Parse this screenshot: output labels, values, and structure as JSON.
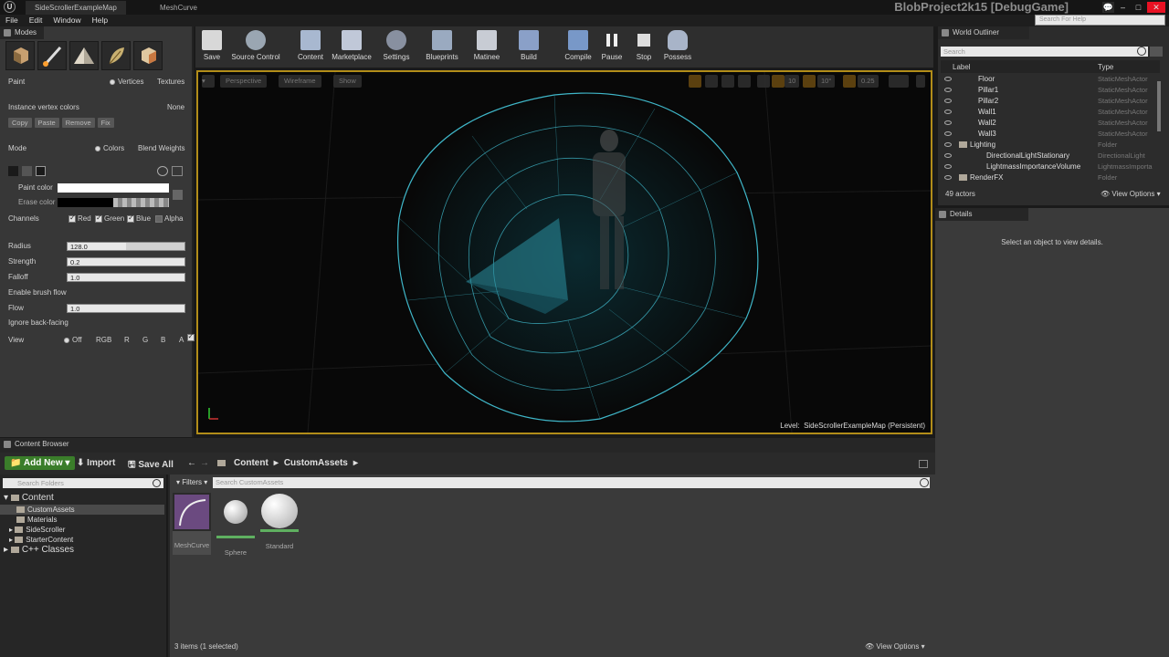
{
  "titlebar": {
    "logo": "U",
    "tabs": [
      "SideScrollerExampleMap",
      "MeshCurve"
    ],
    "project_title": "BlobProject2k15 [DebugGame]",
    "help_search_placeholder": "Search For Help",
    "window_buttons": [
      "–",
      "□",
      "✕"
    ]
  },
  "menubar": {
    "items": [
      "File",
      "Edit",
      "Window",
      "Help"
    ]
  },
  "modes": {
    "tab_label": "Modes",
    "paint_label": "Paint",
    "paint_options": [
      "Vertices",
      "Textures"
    ],
    "instance_vertex_colors": "Instance vertex colors",
    "instance_value": "None",
    "instance_buttons": [
      "Copy",
      "Paste",
      "Remove",
      "Fix"
    ],
    "mode_label": "Mode",
    "mode_options": [
      "Colors",
      "Blend Weights"
    ],
    "paint_color_label": "Paint color",
    "erase_color_label": "Erase color",
    "channels_label": "Channels",
    "channels": [
      "Red",
      "Green",
      "Blue",
      "Alpha"
    ],
    "radius_label": "Radius",
    "radius_value": "128.0",
    "strength_label": "Strength",
    "strength_value": "0.2",
    "falloff_label": "Falloff",
    "falloff_value": "1.0",
    "enable_brush_flow": "Enable brush flow",
    "flow_label": "Flow",
    "flow_value": "1.0",
    "ignore_back_facing": "Ignore back-facing",
    "view_label": "View",
    "view_options": [
      "Off",
      "RGB",
      "R",
      "G",
      "B",
      "A"
    ]
  },
  "toolbar": {
    "buttons": [
      "Save",
      "Source Control",
      "Content",
      "Marketplace",
      "Settings",
      "Blueprints",
      "Matinee",
      "Build",
      "Compile",
      "Pause",
      "Stop",
      "Possess"
    ]
  },
  "viewport": {
    "buttons": [
      "Perspective",
      "Wireframe",
      "Show"
    ],
    "grid_values": [
      "10",
      "10°",
      "0.25"
    ],
    "level_label": "Level:",
    "level_name": "SideScrollerExampleMap (Persistent)"
  },
  "outliner": {
    "tab_label": "World Outliner",
    "search_placeholder": "Search",
    "col_label": "Label",
    "col_type": "Type",
    "rows": [
      {
        "label": "Floor",
        "type": "StaticMeshActor"
      },
      {
        "label": "Pillar1",
        "type": "StaticMeshActor"
      },
      {
        "label": "Pillar2",
        "type": "StaticMeshActor"
      },
      {
        "label": "Wall1",
        "type": "StaticMeshActor"
      },
      {
        "label": "Wall2",
        "type": "StaticMeshActor"
      },
      {
        "label": "Wall3",
        "type": "StaticMeshActor"
      },
      {
        "label": "Lighting",
        "type": "Folder"
      },
      {
        "label": "DirectionalLightStationary",
        "type": "DirectionalLight"
      },
      {
        "label": "LightmassImportanceVolume",
        "type": "LightmassImporta"
      },
      {
        "label": "RenderFX",
        "type": "Folder"
      }
    ],
    "actor_count": "49 actors",
    "view_options": "View Options"
  },
  "details": {
    "tab_label": "Details",
    "empty_message": "Select an object to view details."
  },
  "content_browser": {
    "tab_label": "Content Browser",
    "add_new": "Add New",
    "import": "Import",
    "save_all": "Save All",
    "breadcrumb": [
      "Content",
      "CustomAssets"
    ],
    "search_folders_placeholder": "Search Folders",
    "filters": "Filters",
    "search_assets_placeholder": "Search CustomAssets",
    "tree_root": "Content",
    "tree_items": [
      "CustomAssets",
      "Materials",
      "SideScroller",
      "StarterContent"
    ],
    "tree_cpp": "C++ Classes",
    "assets": [
      "MeshCurve",
      "Sphere",
      "Standard"
    ],
    "status": "3 items (1 selected)",
    "view_options": "View Options"
  },
  "colors": {
    "accent_yellow": "#b28d19",
    "wireframe_cyan": "#3fb6c8",
    "add_new_green": "#3a7d2a"
  }
}
